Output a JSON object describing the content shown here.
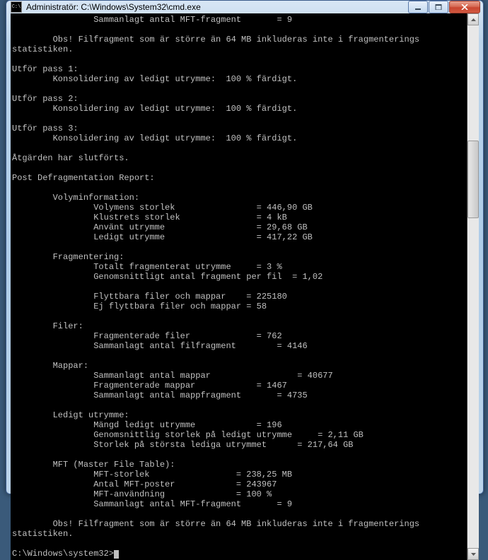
{
  "window": {
    "title": "Administratör: C:\\Windows\\System32\\cmd.exe"
  },
  "console": {
    "lines": [
      "                Sammanlagt antal MFT-fragment       = 9",
      "",
      "        Obs! Filfragment som är större än 64 MB inkluderas inte i fragmenterings",
      "statistiken.",
      "",
      "Utför pass 1:",
      "        Konsolidering av ledigt utrymme:  100 % färdigt.",
      "",
      "Utför pass 2:",
      "        Konsolidering av ledigt utrymme:  100 % färdigt.",
      "",
      "Utför pass 3:",
      "        Konsolidering av ledigt utrymme:  100 % färdigt.",
      "",
      "Åtgärden har slutförts.",
      "",
      "Post Defragmentation Report:",
      "",
      "        Volyminformation:",
      "                Volymens storlek                = 446,90 GB",
      "                Klustrets storlek               = 4 kB",
      "                Använt utrymme                  = 29,68 GB",
      "                Ledigt utrymme                  = 417,22 GB",
      "",
      "        Fragmentering:",
      "                Totalt fragmenterat utrymme     = 3 %",
      "                Genomsnittligt antal fragment per fil  = 1,02",
      "",
      "                Flyttbara filer och mappar    = 225180",
      "                Ej flyttbara filer och mappar = 58",
      "",
      "        Filer:",
      "                Fragmenterade filer             = 762",
      "                Sammanlagt antal filfragment        = 4146",
      "",
      "        Mappar:",
      "                Sammanlagt antal mappar                 = 40677",
      "                Fragmenterade mappar            = 1467",
      "                Sammanlagt antal mappfragment       = 4735",
      "",
      "        Ledigt utrymme:",
      "                Mängd ledigt utrymme            = 196",
      "                Genomsnittlig storlek på ledigt utrymme     = 2,11 GB",
      "                Storlek på största lediga utrymmet      = 217,64 GB",
      "",
      "        MFT (Master File Table):",
      "                MFT-storlek                 = 238,25 MB",
      "                Antal MFT-poster            = 243967",
      "                MFT-användning              = 100 %",
      "                Sammanlagt antal MFT-fragment       = 9",
      "",
      "        Obs! Filfragment som är större än 64 MB inkluderas inte i fragmenterings",
      "statistiken.",
      "",
      "C:\\Windows\\system32>"
    ]
  }
}
